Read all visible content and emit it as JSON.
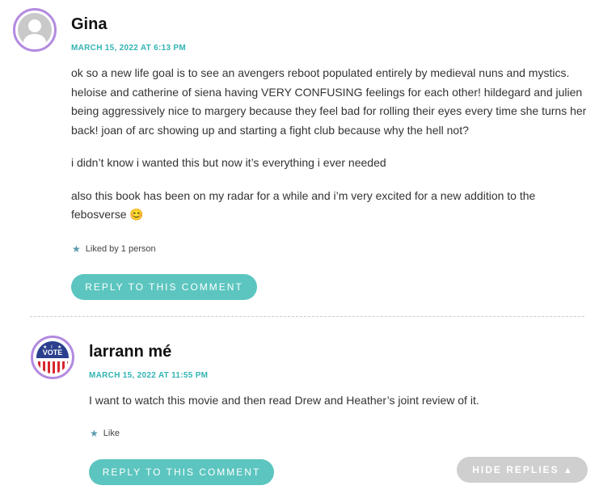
{
  "comments": [
    {
      "author": "Gina",
      "date": "MARCH 15, 2022 AT 6:13 PM",
      "paragraphs": [
        "ok so a new life goal is to see an avengers reboot populated entirely by medieval nuns and mystics. heloise and catherine of siena having VERY CONFUSING feelings for each other! hildegard and julien being aggressively nice to margery because they feel bad for rolling their eyes every time she turns her back! joan of arc showing up and starting a fight club because why the hell not?",
        "i didn’t know i wanted this but now it’s everything i ever needed",
        "also this book has been on my radar for a while and i’m very excited for a new addition to the febosverse"
      ],
      "emoji": "😊",
      "likes": "Liked by 1 person",
      "reply_label": "REPLY TO THIS COMMENT"
    },
    {
      "author": "larrann mé",
      "date": "MARCH 15, 2022 AT 11:55 PM",
      "avatar_text": "VOTE",
      "paragraphs": [
        "I want to watch this movie and then read Drew and Heather’s joint review of it."
      ],
      "likes": "Like",
      "reply_label": "REPLY TO THIS COMMENT"
    }
  ],
  "hide_replies_label": "HIDE REPLIES",
  "colors": {
    "accent_teal": "#5cc5bf",
    "date_teal": "#33b3b3",
    "avatar_border": "#b38ae0",
    "hide_button": "#cfcfcf"
  }
}
